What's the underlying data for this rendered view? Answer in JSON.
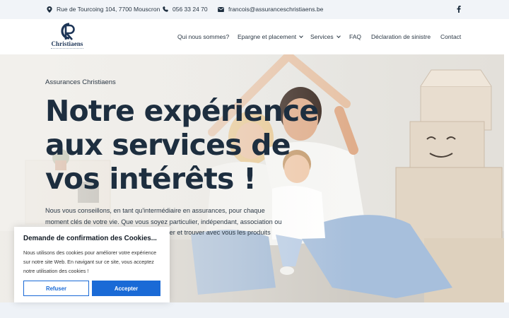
{
  "topbar": {
    "address": "Rue de Tourcoing 104, 7700 Mouscron",
    "phone": "056 33 24 70",
    "email": "francois@assuranceschristiaens.be",
    "social_icon": "facebook-icon"
  },
  "brand": {
    "logo_text": "Christiaens"
  },
  "nav": {
    "items": [
      {
        "label": "Qui nous sommes?",
        "dropdown": false
      },
      {
        "label": "Epargne et placement",
        "dropdown": true
      },
      {
        "label": "Services",
        "dropdown": true
      },
      {
        "label": "FAQ",
        "dropdown": false
      },
      {
        "label": "Déclaration de sinistre",
        "dropdown": false
      },
      {
        "label": "Contact",
        "dropdown": false
      }
    ]
  },
  "hero": {
    "eyebrow": "Assurances Christiaens",
    "title_lines": [
      "Notre expérience",
      "aux services de",
      "vos intérêts !"
    ],
    "text": "Nous vous conseillons, en tant qu'intermédiaire en assurances, pour chaque moment clés de votre vie. Que vous soyez particulier, indépendant, association ou entreprise, nous sommes là pour vous guider et trouver avec vous les produits"
  },
  "cookie": {
    "title": "Demande de confirmation des Cookies...",
    "text": "Nous utilisons des cookies pour améliorer votre expérience sur notre site Web. En navigant sur ce site, vous acceptez notre utilisation des cookies !",
    "refuse_label": "Refuser",
    "accept_label": "Accepter"
  },
  "colors": {
    "accent": "#1a6ad6",
    "heading": "#1d2e3f",
    "topbar_bg": "#f1f4f8"
  }
}
